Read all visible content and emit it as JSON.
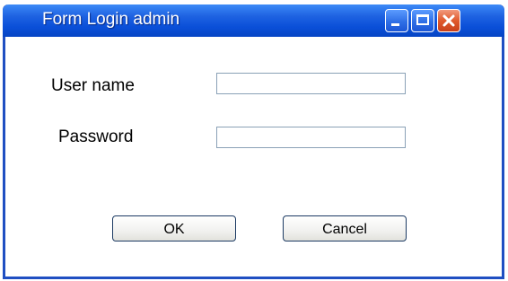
{
  "window": {
    "title": "Form Login admin",
    "controls": {
      "minimize_icon": "minimize-icon",
      "maximize_icon": "maximize-icon",
      "close_icon": "close-icon"
    }
  },
  "form": {
    "username": {
      "label": "User name",
      "value": "",
      "placeholder": ""
    },
    "password": {
      "label": "Password",
      "value": "",
      "placeholder": ""
    }
  },
  "buttons": {
    "ok_label": "OK",
    "cancel_label": "Cancel"
  },
  "colors": {
    "titlebar": "#0a4fd8",
    "close_button": "#e05a2d",
    "frame_border": "#1f4fc2"
  }
}
